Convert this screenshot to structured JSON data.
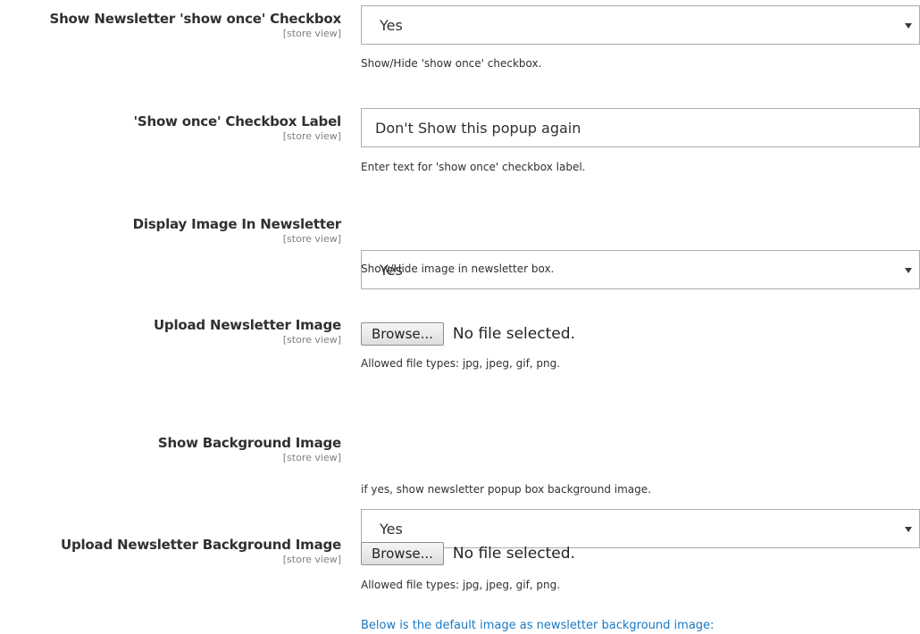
{
  "fields": [
    {
      "label": "Show Newsletter 'show once' Checkbox",
      "scope": "[store view]",
      "type": "select",
      "value": "Yes",
      "note": "Show/Hide 'show once' checkbox."
    },
    {
      "label": "'Show once' Checkbox Label",
      "scope": "[store view]",
      "type": "text",
      "value": "Don't Show this popup again",
      "note": "Enter text for 'show once' checkbox label."
    },
    {
      "label": "Display Image In Newsletter",
      "scope": "[store view]",
      "type": "select",
      "value": "Yes",
      "note": "Show/Hide image in newsletter box."
    },
    {
      "label": "Upload Newsletter Image",
      "scope": "[store view]",
      "type": "file",
      "button": "Browse...",
      "status": "No file selected.",
      "note": "Allowed file types: jpg, jpeg, gif, png."
    },
    {
      "label": "Show Background Image",
      "scope": "[store view]",
      "type": "select",
      "value": "Yes",
      "note": "if yes, show newsletter popup box background image."
    },
    {
      "label": "Upload Newsletter Background Image",
      "scope": "[store view]",
      "type": "file",
      "button": "Browse...",
      "status": "No file selected.",
      "note": "Allowed file types: jpg, jpeg, gif, png."
    }
  ],
  "default_image_note": "Below is the default image as newsletter background image:",
  "icons": {
    "select_arrow": "chevron-down-icon"
  },
  "colors": {
    "link": "#1979c3",
    "border": "#adadad",
    "scope": "#808080"
  }
}
